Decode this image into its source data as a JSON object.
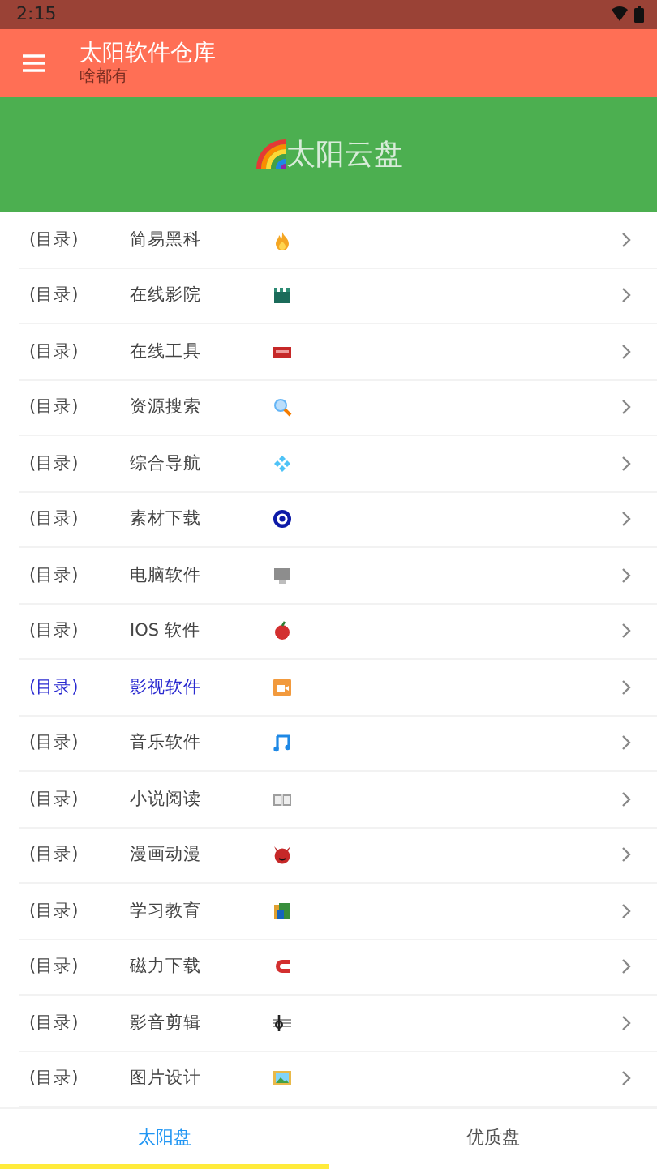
{
  "status_bar": {
    "time": "2:15"
  },
  "app_bar": {
    "title": "太阳软件仓库",
    "subtitle": "啥都有"
  },
  "banner": {
    "title": "太阳云盘"
  },
  "list": [
    {
      "tag": "(目录)",
      "name": "简易黑科",
      "selected": false
    },
    {
      "tag": "(目录)",
      "name": "在线影院",
      "selected": false
    },
    {
      "tag": "(目录)",
      "name": "在线工具",
      "selected": false
    },
    {
      "tag": "(目录)",
      "name": "资源搜索",
      "selected": false
    },
    {
      "tag": "(目录)",
      "name": "综合导航",
      "selected": false
    },
    {
      "tag": "(目录)",
      "name": "素材下载",
      "selected": false
    },
    {
      "tag": "(目录)",
      "name": "电脑软件",
      "selected": false
    },
    {
      "tag": "(目录)",
      "name": "IOS 软件",
      "selected": false
    },
    {
      "tag": "(目录)",
      "name": "影视软件",
      "selected": true
    },
    {
      "tag": "(目录)",
      "name": "音乐软件",
      "selected": false
    },
    {
      "tag": "(目录)",
      "name": "小说阅读",
      "selected": false
    },
    {
      "tag": "(目录)",
      "name": "漫画动漫",
      "selected": false
    },
    {
      "tag": "(目录)",
      "name": "学习教育",
      "selected": false
    },
    {
      "tag": "(目录)",
      "name": "磁力下载",
      "selected": false
    },
    {
      "tag": "(目录)",
      "name": "影音剪辑",
      "selected": false
    },
    {
      "tag": "(目录)",
      "name": "图片设计",
      "selected": false
    }
  ],
  "bottom_tabs": [
    {
      "label": "太阳盘",
      "selected": true
    },
    {
      "label": "优质盘",
      "selected": false
    }
  ]
}
